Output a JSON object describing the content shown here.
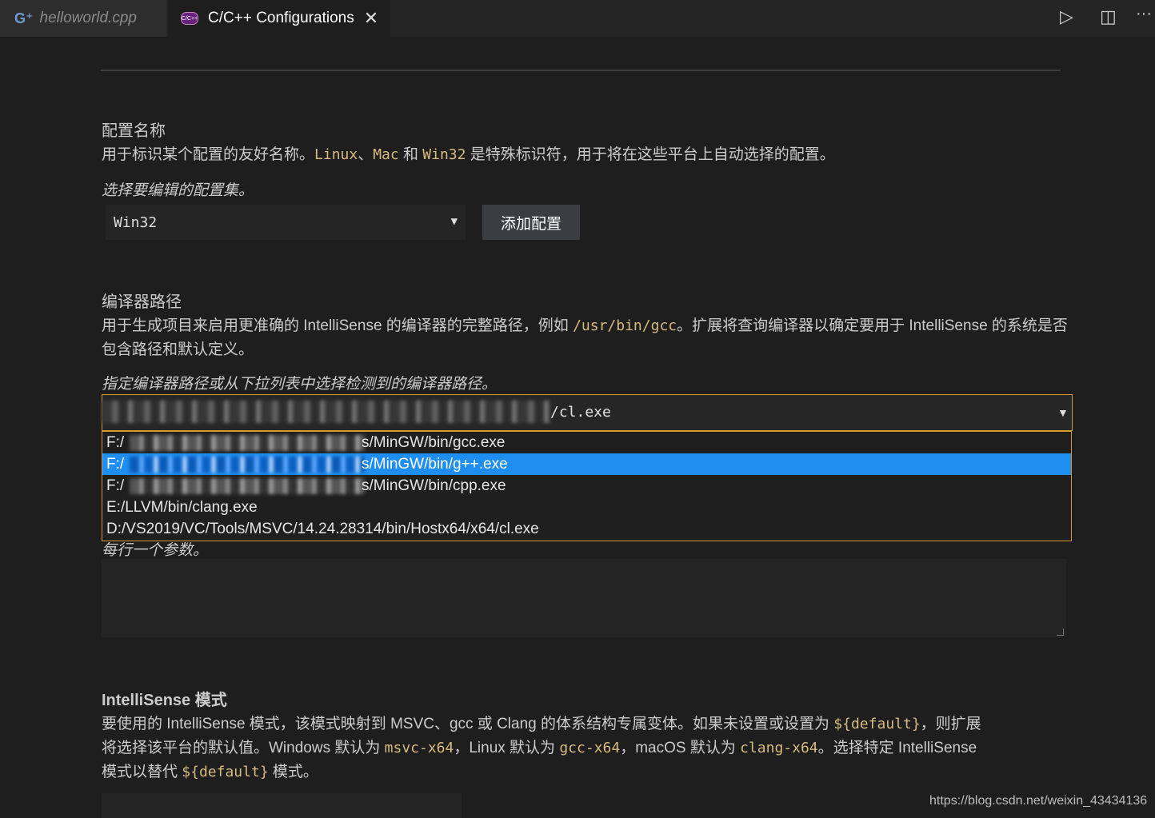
{
  "tabs": [
    {
      "label": "helloworld.cpp",
      "icon": "cpp-file-icon"
    },
    {
      "label": "C/C++ Configurations",
      "icon": "cpp-config-icon",
      "icon_text": "C/C++",
      "close": "✕"
    }
  ],
  "toolbar": {
    "run": "▷",
    "split": "◫",
    "more": "···"
  },
  "config_name": {
    "heading": "配置名称",
    "desc_1": "用于标识某个配置的友好名称。",
    "code_linux": "Linux",
    "sep_1": "、",
    "code_mac": "Mac",
    "and": " 和 ",
    "code_win32": "Win32",
    "desc_2": " 是特殊标识符，用于将在这些平台上自动选择的配置。",
    "select_label": "选择要编辑的配置集。",
    "selected": "Win32",
    "add_button": "添加配置"
  },
  "compiler_path": {
    "heading": "编译器路径",
    "desc_1": "用于生成项目来启用更准确的 IntelliSense 的编译器的完整路径，例如 ",
    "code_example": "/usr/bin/gcc",
    "desc_2": "。扩展将查询编译器以确定要用于 IntelliSense 的系统是否包含路径和默认定义。",
    "input_label": "指定编译器路径或从下拉列表中选择检测到的编译器路径。",
    "current_value_suffix": "/cl.exe",
    "options": [
      {
        "prefix": "F:/",
        "suffix": "s/MinGW/bin/gcc.exe"
      },
      {
        "prefix": "F:/",
        "suffix": "s/MinGW/bin/g++.exe"
      },
      {
        "prefix": "F:/",
        "suffix": "s/MinGW/bin/cpp.exe"
      },
      {
        "text": "E:/LLVM/bin/clang.exe"
      },
      {
        "text": "D:/VS2019/VC/Tools/MSVC/14.24.28314/bin/Hostx64/x64/cl.exe"
      }
    ]
  },
  "compiler_args": {
    "hint": "每行一个参数。"
  },
  "intellisense_mode": {
    "heading": "IntelliSense 模式",
    "desc_1": "要使用的 IntelliSense 模式，该模式映射到 MSVC、gcc 或 Clang 的体系结构专属变体。如果未设置或设置为 ",
    "code_default": "${default}",
    "desc_2": "，则扩展",
    "desc_3": "将选择该平台的默认值。Windows 默认为 ",
    "code_msvc": "msvc-x64",
    "desc_4": "，Linux 默认为 ",
    "code_gcc": "gcc-x64",
    "desc_5": "，macOS 默认为 ",
    "code_clang": "clang-x64",
    "desc_6": "。选择特定 IntelliSense",
    "desc_7": "模式以替代 ",
    "code_default_2": "${default}",
    "desc_8": " 模式。"
  },
  "watermark": "https://blog.csdn.net/weixin_43434136",
  "colors": {
    "accent_border": "#d69a2d",
    "selection": "#1e8ef0",
    "code": "#d7ba7d",
    "background": "#1e1e1e"
  }
}
